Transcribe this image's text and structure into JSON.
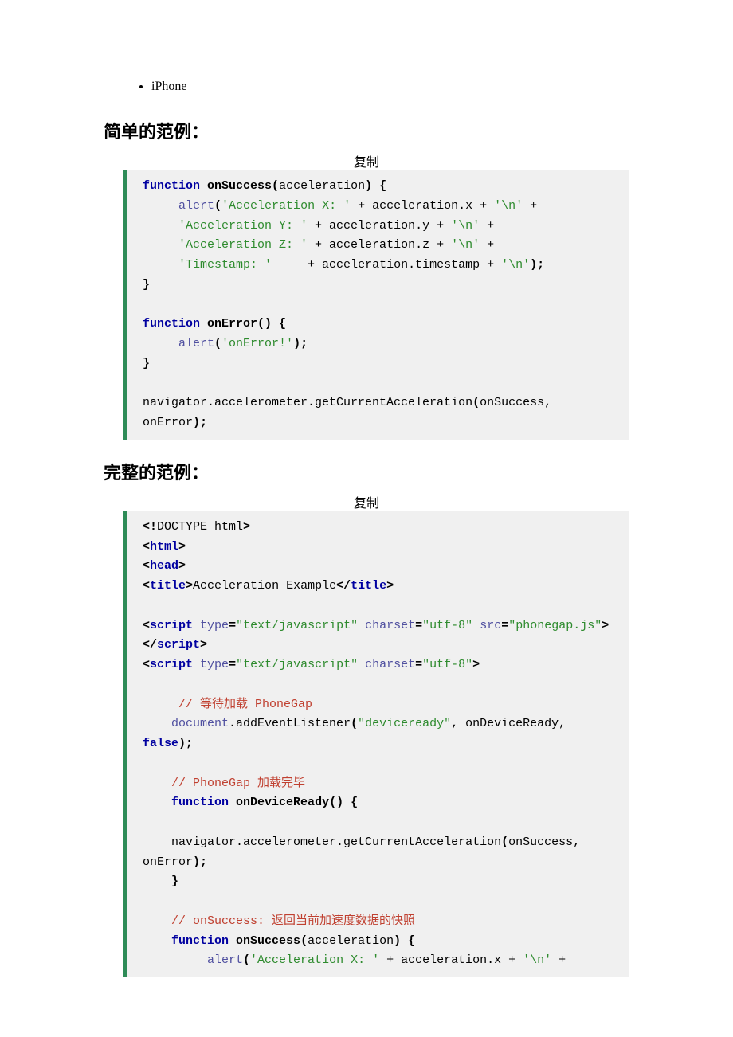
{
  "list": {
    "items": [
      "iPhone"
    ]
  },
  "sections": {
    "simple": {
      "title": "简单的范例：",
      "copy": "复制"
    },
    "full": {
      "title": "完整的范例：",
      "copy": "复制"
    }
  },
  "code_simple": {
    "l1_kw1": "function",
    "l1_fn": "onSuccess",
    "l1_p1": "(",
    "l1_arg": "acceleration",
    "l1_p2": ")",
    "l1_p3": " {",
    "l2_id": "alert",
    "l2_p1": "(",
    "l2_s": "'Acceleration X: '",
    "l2_pl": " + acceleration.x + ",
    "l2_s2": "'\\n'",
    "l2_pl2": " +",
    "l3_s": "'Acceleration Y: '",
    "l3_pl": " + acceleration.y + ",
    "l3_s2": "'\\n'",
    "l3_pl2": " +",
    "l4_s": "'Acceleration Z: '",
    "l4_pl": " + acceleration.z + ",
    "l4_s2": "'\\n'",
    "l4_pl2": " +",
    "l5_s": "'Timestamp: '",
    "l5_pl": "     + acceleration.timestamp + ",
    "l5_s2": "'\\n'",
    "l5_p": ");",
    "l6_p": "}",
    "l8_kw": "function",
    "l8_fn": "onError",
    "l8_p": "() {",
    "l9_id": "alert",
    "l9_p1": "(",
    "l9_s": "'onError!'",
    "l9_p2": ");",
    "l10_p": "}",
    "l12_pl": "navigator.accelerometer.getCurrentAcceleration",
    "l12_p1": "(",
    "l12_pl2": "onSuccess, onError",
    "l12_p2": ");"
  },
  "code_full": {
    "l1_p1": "<!",
    "l1_pl": "DOCTYPE html",
    "l1_p2": ">",
    "l2_p1": "<",
    "l2_t": "html",
    "l2_p2": ">",
    "l3_p1": "<",
    "l3_t": "head",
    "l3_p2": ">",
    "l4_p1": "<",
    "l4_t": "title",
    "l4_p2": ">",
    "l4_pl": "Acceleration Example",
    "l4_p3": "</",
    "l4_t2": "title",
    "l4_p4": ">",
    "l6_p1": "<",
    "l6_t": "script",
    "l6_sp": " ",
    "l6_a1": "type",
    "l6_eq": "=",
    "l6_v1": "\"text/javascript\"",
    "l6_sp2": " ",
    "l6_a2": "charset",
    "l6_v2": "\"utf-8\"",
    "l6_sp3": " ",
    "l6_a3": "src",
    "l6_v3": "\"phonegap.js\"",
    "l6_p2": "></",
    "l6_t2": "script",
    "l6_p3": ">",
    "l7_p1": "<",
    "l7_t": "script",
    "l7_sp": " ",
    "l7_a1": "type",
    "l7_eq": "=",
    "l7_v1": "\"text/javascript\"",
    "l7_sp2": " ",
    "l7_a2": "charset",
    "l7_v2": "\"utf-8\"",
    "l7_p2": ">",
    "l9_c": "// 等待加载 PhoneGap",
    "l10_id": "document",
    "l10_pl": ".addEventListener",
    "l10_p1": "(",
    "l10_s": "\"deviceready\"",
    "l10_pl2": ", onDeviceReady, ",
    "l10_kw": "false",
    "l10_p2": ");",
    "l12_c": "// PhoneGap 加载完毕",
    "l13_kw": "function",
    "l13_fn": "onDeviceReady",
    "l13_p": "() {",
    "l15_pl": "navigator.accelerometer.getCurrentAcceleration",
    "l15_p1": "(",
    "l15_pl2": "onSuccess, onError",
    "l15_p2": ");",
    "l16_p": "}",
    "l18_c": "// onSuccess: 返回当前加速度数据的快照",
    "l19_kw": "function",
    "l19_fn": "onSuccess",
    "l19_p1": "(",
    "l19_arg": "acceleration",
    "l19_p2": ") {",
    "l20_id": "alert",
    "l20_p1": "(",
    "l20_s": "'Acceleration X: '",
    "l20_pl": " + acceleration.x + ",
    "l20_s2": "'\\n'",
    "l20_pl2": " +"
  }
}
